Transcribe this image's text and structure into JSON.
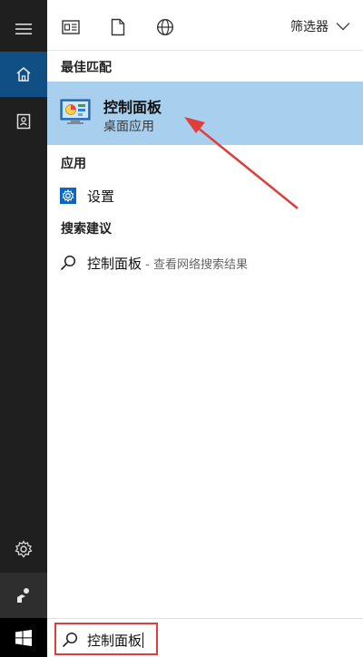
{
  "toolbar": {
    "filter_label": "筛选器"
  },
  "sections": {
    "best_match": "最佳匹配",
    "apps": "应用",
    "suggestions": "搜索建议"
  },
  "best_match": {
    "title": "控制面板",
    "subtitle": "桌面应用"
  },
  "apps": [
    {
      "label": "设置",
      "icon": "gear-icon"
    }
  ],
  "suggestion": {
    "query": "控制面板",
    "hint": " - 查看网络搜索结果"
  },
  "search": {
    "value": "控制面板"
  },
  "colors": {
    "rail": "#1f1f1f",
    "rail_active": "#0f4f83",
    "highlight": "#a9cfee",
    "annotation": "#e03d3d",
    "settings_icon": "#0a66c2"
  },
  "icons": [
    "hamburger-icon",
    "home-icon",
    "notebook-icon",
    "gear-icon",
    "feedback-icon",
    "windows-logo-icon",
    "document-icon",
    "file-icon",
    "globe-icon",
    "chevron-down-icon",
    "control-panel-icon",
    "search-icon"
  ]
}
